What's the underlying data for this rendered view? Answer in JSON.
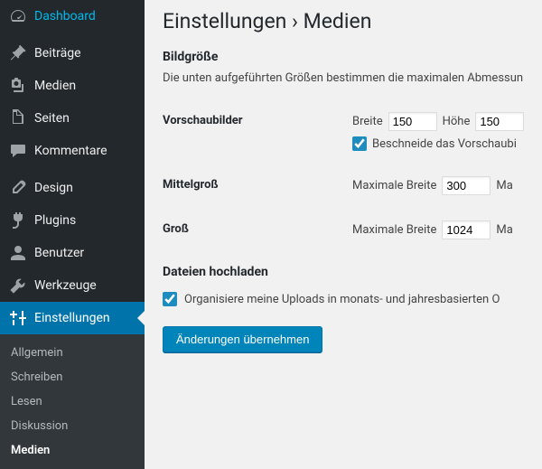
{
  "sidebar": {
    "items": [
      {
        "id": "dashboard",
        "label": "Dashboard"
      },
      {
        "id": "posts",
        "label": "Beiträge"
      },
      {
        "id": "media",
        "label": "Medien"
      },
      {
        "id": "pages",
        "label": "Seiten"
      },
      {
        "id": "comments",
        "label": "Kommentare"
      },
      {
        "id": "appearance",
        "label": "Design"
      },
      {
        "id": "plugins",
        "label": "Plugins"
      },
      {
        "id": "users",
        "label": "Benutzer"
      },
      {
        "id": "tools",
        "label": "Werkzeuge"
      },
      {
        "id": "settings",
        "label": "Einstellungen"
      }
    ],
    "submenu": [
      {
        "label": "Allgemein"
      },
      {
        "label": "Schreiben"
      },
      {
        "label": "Lesen"
      },
      {
        "label": "Diskussion"
      },
      {
        "label": "Medien",
        "current": true
      }
    ]
  },
  "page": {
    "title": "Einstellungen › Medien",
    "section_sizes": "Bildgröße",
    "desc": "Die unten aufgeführten Größen bestimmen die maximalen Abmessun",
    "thumb_label": "Vorschaubilder",
    "width_label": "Breite",
    "height_label": "Höhe",
    "thumb_width": "150",
    "thumb_height": "150",
    "thumb_crop": "Beschneide das Vorschaubi",
    "medium_label": "Mittelgroß",
    "max_width_label": "Maximale Breite",
    "medium_width": "300",
    "medium_trail": "Ma",
    "large_label": "Groß",
    "large_width": "1024",
    "large_trail": "Ma",
    "section_upload": "Dateien hochladen",
    "organize": "Organisiere meine Uploads in monats- und jahresbasierten O",
    "save": "Änderungen übernehmen"
  }
}
